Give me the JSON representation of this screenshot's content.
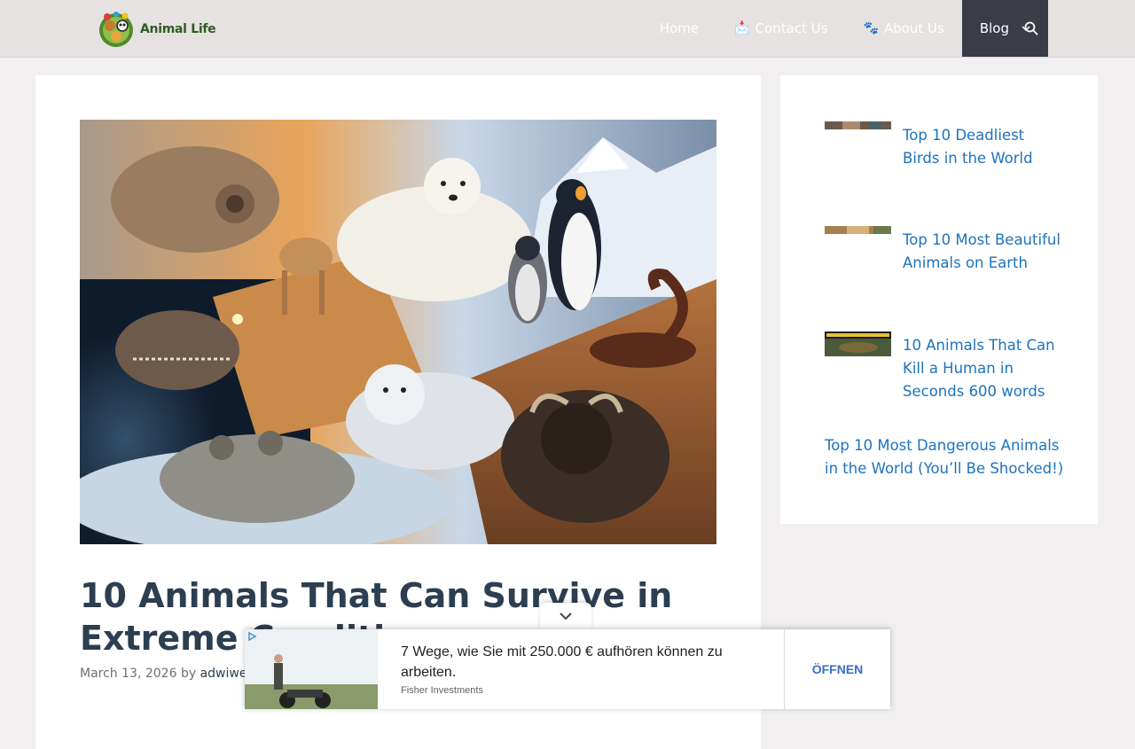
{
  "site": {
    "logo_text": "Animal Life"
  },
  "nav": {
    "items": [
      {
        "label": "Home",
        "emoji": ""
      },
      {
        "label": "Contact Us",
        "emoji": "📩"
      },
      {
        "label": "About Us",
        "emoji": "🐾"
      },
      {
        "label": "Blog",
        "emoji": ""
      }
    ],
    "active": "Blog",
    "search_icon": "search-icon"
  },
  "article": {
    "title": "10 Animals That Can Survive in Extreme Conditions",
    "date": "March 13, 2026",
    "by": "by",
    "author": "adwiwed"
  },
  "sidebar": {
    "posts": [
      {
        "title": "Top 10 Deadliest Birds in the World"
      },
      {
        "title": "Top 10 Most Beautiful Animals on Earth"
      },
      {
        "title": "10 Animals That Can Kill a Human in Seconds 600 words"
      }
    ],
    "plain_post": "Top 10 Most Dangerous Animals in the World (You’ll Be Shocked!)"
  },
  "ad": {
    "headline": "7 Wege, wie Sie mit 250.000 € aufhören können zu arbeiten.",
    "source": "Fisher Investments",
    "cta": "ÖFFNEN"
  },
  "colors": {
    "header_bg": "#e6e2e1",
    "nav_active_bg": "#3a3d46",
    "link": "#1e73be",
    "title": "#2c3e50"
  }
}
